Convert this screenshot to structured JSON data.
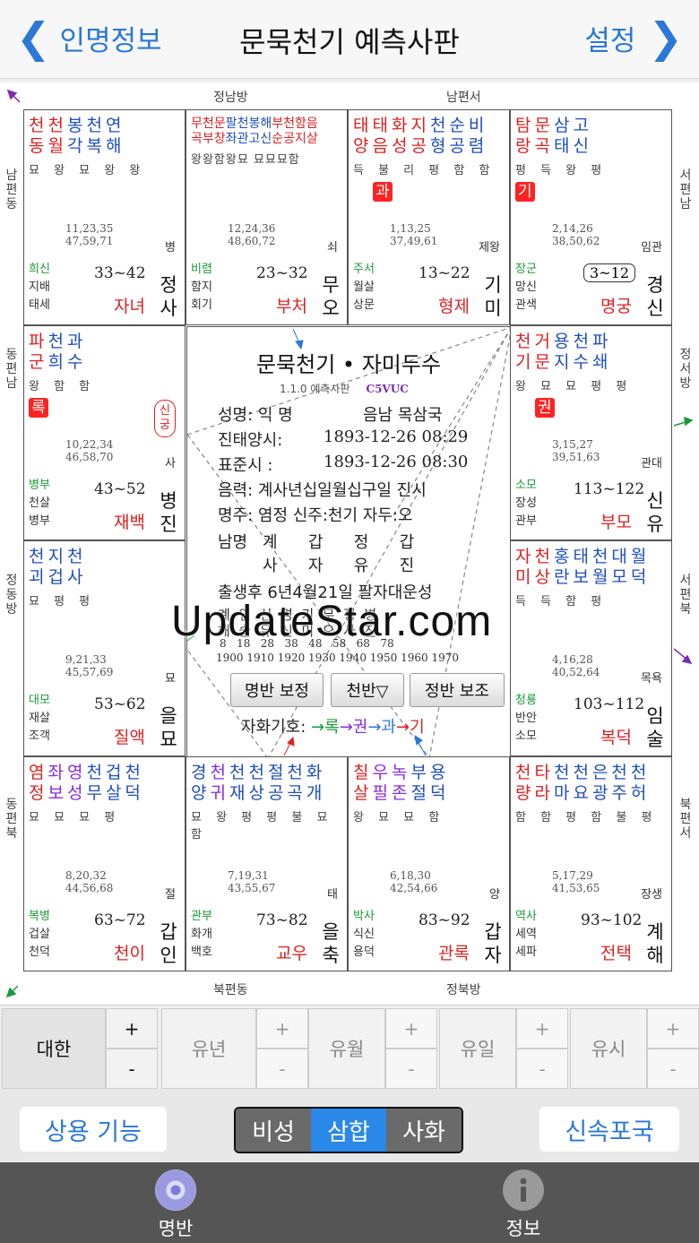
{
  "nav": {
    "back": "인명정보",
    "title": "문묵천기 예측사판",
    "right": "설정"
  },
  "directions": {
    "top_left": "정남방",
    "top_right": "남편서",
    "bottom_left": "북편동",
    "bottom_right": "정북방",
    "left_1": "남편동",
    "left_2": "동편남",
    "left_3": "정동방",
    "left_4": "동편북",
    "right_1": "서편남",
    "right_2": "정서방",
    "right_3": "서편북",
    "right_4": "북편서"
  },
  "cells": {
    "c0": {
      "stars": [
        [
          "천",
          "red"
        ],
        [
          "천",
          "red"
        ],
        [
          "봉",
          "blue"
        ],
        [
          "천",
          "blue"
        ],
        [
          "연",
          "blue"
        ]
      ],
      "stars2": [
        [
          "동",
          "red"
        ],
        [
          "월",
          "red"
        ],
        [
          "각",
          "blue"
        ],
        [
          "복",
          "blue"
        ],
        [
          "해",
          "blue"
        ]
      ],
      "bright": "묘 왕 묘 왕 왕",
      "ages1": "11,23,35",
      "ages2": "47,59,71",
      "unsung": "병",
      "s1": "희신",
      "s2": "지배",
      "s3": "태세",
      "range": "33~42",
      "palace": "자녀",
      "ganji": "정사"
    },
    "c1": {
      "row1": "무천문팔천봉해부천함음",
      "row2": "곡부창좌관고신순공지살",
      "bright": "왕왕함왕묘 묘묘묘함",
      "ages1": "12,24,36",
      "ages2": "48,60,72",
      "unsung": "쇠",
      "s1": "비렴",
      "s2": "함지",
      "s3": "회기",
      "range": "23~32",
      "palace": "부처",
      "ganji": "무오"
    },
    "c2": {
      "stars": [
        [
          "태",
          "red"
        ],
        [
          "태",
          "red"
        ],
        [
          "화",
          "red"
        ],
        [
          "지",
          "red"
        ],
        [
          "천",
          "blue"
        ],
        [
          "순",
          "blue"
        ],
        [
          "비",
          "blue"
        ]
      ],
      "stars2": [
        [
          "양",
          "red"
        ],
        [
          "음",
          "red"
        ],
        [
          "성",
          "red"
        ],
        [
          "공",
          "red"
        ],
        [
          "형",
          "blue"
        ],
        [
          "공",
          "blue"
        ],
        [
          "렴",
          "blue"
        ]
      ],
      "bright": "득 불 리 평 함 함",
      "badge": "과",
      "ages1": "1,13,25",
      "ages2": "37,49,61",
      "unsung": "제왕",
      "s1": "주서",
      "s2": "월살",
      "s3": "상문",
      "range": "13~22",
      "palace": "형제",
      "ganji": "기미"
    },
    "c3": {
      "stars": [
        [
          "탐",
          "red"
        ],
        [
          "문",
          "red"
        ],
        [
          "삼",
          "blue"
        ],
        [
          "고",
          "blue"
        ]
      ],
      "stars2": [
        [
          "랑",
          "red"
        ],
        [
          "곡",
          "red"
        ],
        [
          "태",
          "blue"
        ],
        [
          "신",
          "blue"
        ]
      ],
      "bright": "평 득 왕 평",
      "badge": "기",
      "ages1": "2,14,26",
      "ages2": "38,50,62",
      "unsung": "임관",
      "s1": "장군",
      "s2": "망신",
      "s3": "관색",
      "age2": "3~12",
      "range": "",
      "palace": "명궁",
      "ganji": "경신"
    },
    "c4": {
      "stars": [
        [
          "파",
          "red"
        ],
        [
          "천",
          "blue"
        ],
        [
          "과",
          "blue"
        ]
      ],
      "stars2": [
        [
          "군",
          "red"
        ],
        [
          "희",
          "blue"
        ],
        [
          "수",
          "blue"
        ]
      ],
      "bright": "왕 함 함",
      "badge": "록",
      "singung": "신궁",
      "ages1": "10,22,34",
      "ages2": "46,58,70",
      "unsung": "사",
      "s1": "병부",
      "s2": "천살",
      "s3": "병부",
      "range": "43~52",
      "palace": "재백",
      "ganji": "병진"
    },
    "c5": {
      "stars": [
        [
          "천",
          "red"
        ],
        [
          "거",
          "red"
        ],
        [
          "용",
          "blue"
        ],
        [
          "천",
          "blue"
        ],
        [
          "파",
          "blue"
        ]
      ],
      "stars2": [
        [
          "기",
          "red"
        ],
        [
          "문",
          "red"
        ],
        [
          "지",
          "blue"
        ],
        [
          "수",
          "blue"
        ],
        [
          "쇄",
          "blue"
        ]
      ],
      "bright": "왕 묘 묘 평 평",
      "badge": "권",
      "ages1": "3,15,27",
      "ages2": "39,51,63",
      "unsung": "관대",
      "s1": "소모",
      "s2": "장성",
      "s3": "관부",
      "range": "113~122",
      "palace": "부모",
      "ganji": "신유"
    },
    "c6": {
      "stars": [
        [
          "천",
          "blue"
        ],
        [
          "지",
          "blue"
        ],
        [
          "천",
          "blue"
        ]
      ],
      "stars2": [
        [
          "괴",
          "blue"
        ],
        [
          "겁",
          "blue"
        ],
        [
          "사",
          "blue"
        ]
      ],
      "bright": "묘 평 평",
      "ages1": "9,21,33",
      "ages2": "45,57,69",
      "unsung": "묘",
      "s1": "대모",
      "s2": "재살",
      "s3": "조객",
      "range": "53~62",
      "palace": "질액",
      "ganji": "을묘"
    },
    "c7": {
      "stars": [
        [
          "자",
          "red"
        ],
        [
          "천",
          "red"
        ],
        [
          "홍",
          "blue"
        ],
        [
          "태",
          "blue"
        ],
        [
          "천",
          "blue"
        ],
        [
          "대",
          "blue"
        ],
        [
          "월",
          "blue"
        ]
      ],
      "stars2": [
        [
          "미",
          "red"
        ],
        [
          "상",
          "red"
        ],
        [
          "란",
          "blue"
        ],
        [
          "보",
          "blue"
        ],
        [
          "월",
          "blue"
        ],
        [
          "모",
          "blue"
        ],
        [
          "덕",
          "blue"
        ]
      ],
      "bright": "득 득 함 평",
      "ages1": "4,16,28",
      "ages2": "40,52,64",
      "unsung": "목욕",
      "s1": "청룡",
      "s2": "반안",
      "s3": "소모",
      "range": "103~112",
      "palace": "복덕",
      "ganji": "임술"
    },
    "c8": {
      "stars": [
        [
          "염",
          "red"
        ],
        [
          "좌",
          "purple"
        ],
        [
          "영",
          "purple"
        ],
        [
          "천",
          "blue"
        ],
        [
          "겁",
          "blue"
        ],
        [
          "천",
          "blue"
        ]
      ],
      "stars2": [
        [
          "정",
          "red"
        ],
        [
          "보",
          "purple"
        ],
        [
          "성",
          "purple"
        ],
        [
          "무",
          "blue"
        ],
        [
          "살",
          "blue"
        ],
        [
          "덕",
          "blue"
        ]
      ],
      "bright": "묘 묘 묘 평",
      "ages1": "8,20,32",
      "ages2": "44,56,68",
      "unsung": "절",
      "s1": "복병",
      "s2": "겁살",
      "s3": "천덕",
      "range": "63~72",
      "palace": "천이",
      "ganji": "갑인"
    },
    "c9": {
      "stars": [
        [
          "경",
          "blue"
        ],
        [
          "천",
          "purple"
        ],
        [
          "천",
          "blue"
        ],
        [
          "천",
          "blue"
        ],
        [
          "절",
          "blue"
        ],
        [
          "천",
          "blue"
        ],
        [
          "화",
          "blue"
        ]
      ],
      "stars2": [
        [
          "양",
          "blue"
        ],
        [
          "귀",
          "purple"
        ],
        [
          "재",
          "blue"
        ],
        [
          "상",
          "blue"
        ],
        [
          "공",
          "blue"
        ],
        [
          "곡",
          "blue"
        ],
        [
          "개",
          "blue"
        ]
      ],
      "bright": "묘 왕 평 평 불 묘 함",
      "ages1": "7,19,31",
      "ages2": "43,55,67",
      "unsung": "태",
      "s1": "관부",
      "s2": "화개",
      "s3": "백호",
      "range": "73~82",
      "palace": "교우",
      "ganji": "을축"
    },
    "c10": {
      "stars": [
        [
          "칠",
          "red"
        ],
        [
          "우",
          "purple"
        ],
        [
          "녹",
          "purple"
        ],
        [
          "부",
          "blue"
        ],
        [
          "용",
          "blue"
        ]
      ],
      "stars2": [
        [
          "살",
          "red"
        ],
        [
          "필",
          "purple"
        ],
        [
          "존",
          "purple"
        ],
        [
          "절",
          "blue"
        ],
        [
          "덕",
          "blue"
        ]
      ],
      "bright": "왕 묘 묘 함",
      "ages1": "6,18,30",
      "ages2": "42,54,66",
      "unsung": "양",
      "s1": "박사",
      "s2": "식신",
      "s3": "용덕",
      "range": "83~92",
      "palace": "관록",
      "ganji": "갑자"
    },
    "c11": {
      "stars": [
        [
          "천",
          "red"
        ],
        [
          "타",
          "red"
        ],
        [
          "천",
          "blue"
        ],
        [
          "천",
          "blue"
        ],
        [
          "은",
          "blue"
        ],
        [
          "천",
          "blue"
        ],
        [
          "천",
          "blue"
        ]
      ],
      "stars2": [
        [
          "량",
          "red"
        ],
        [
          "라",
          "red"
        ],
        [
          "마",
          "blue"
        ],
        [
          "요",
          "blue"
        ],
        [
          "광",
          "blue"
        ],
        [
          "주",
          "blue"
        ],
        [
          "허",
          "blue"
        ]
      ],
      "bright": "함 함 평 함 불 평",
      "ages1": "5,17,29",
      "ages2": "41,53,65",
      "unsung": "장생",
      "s1": "역사",
      "s2": "세역",
      "s3": "세파",
      "range": "93~102",
      "palace": "전택",
      "ganji": "계해"
    }
  },
  "center": {
    "title": "문묵천기 • 자미두수",
    "version": "1.1.0 예측사판",
    "code": "C5VUC",
    "name": "성명: 익 명",
    "gender": "음남 목삼국",
    "solar": "진태양시:",
    "solar_val": "1893-12-26  08:29",
    "std": "표준시    :",
    "std_val": "1893-12-26  08:30",
    "lunar": "음력: 계사년십일월십구일 진시",
    "mingzhu": "명주: 염정 신주:천기  자두:오",
    "pillar_label": "남명",
    "pillar_top": "계      갑      정      갑",
    "pillar_bot": "사      자      유      진",
    "daewoon": "출생후 6년4월21일 팔자대운성",
    "dw_gan": "계  임  신  경  기  무  정  병",
    "dw_ji": "해  술  유  신  미  오  사  진",
    "dw_ages": "8   18   28   38   48   58   68   78",
    "dw_years": "1900 1910 1920 1930 1940 1950 1960 1970",
    "btn1": "명반 보정",
    "btn2": "천반▽",
    "btn3": "정반 보조",
    "hwa_label": "자화기호: ",
    "hwa1": "→록",
    "hwa2": "→권",
    "hwa3": "→과",
    "hwa4": "→기"
  },
  "watermark": "UpdateStar.com",
  "steppers": {
    "s1": "대한",
    "s2": "유년",
    "s3": "유월",
    "s4": "유일",
    "s5": "유시",
    "plus": "+",
    "minus": "-"
  },
  "toolbar": {
    "left": "상용 기능",
    "seg1": "비성",
    "seg2": "삼합",
    "seg3": "사화",
    "right": "신속포국"
  },
  "tabs": {
    "t1": "명반",
    "t2": "정보"
  },
  "colors": {
    "accent": "#2a78d8",
    "red": "#e02020",
    "blue": "#1e4fbf",
    "purple": "#8a2be2"
  }
}
